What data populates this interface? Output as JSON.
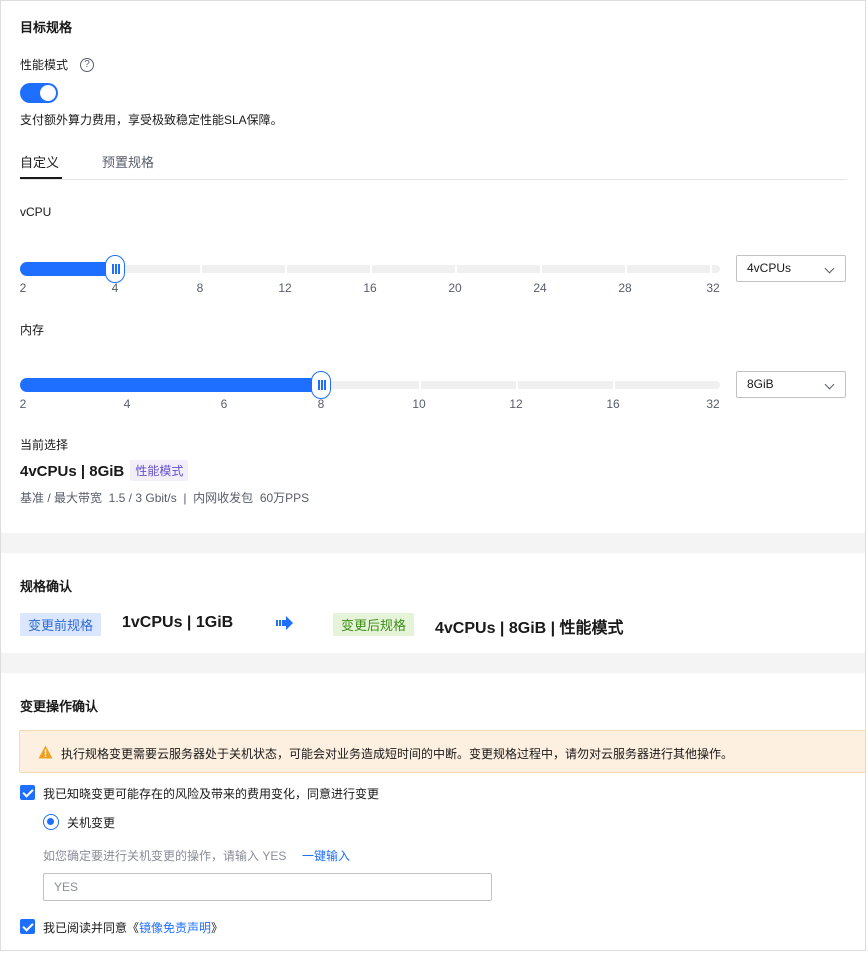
{
  "target_spec": {
    "title": "目标规格",
    "perf_mode_label": "性能模式",
    "help_glyph": "?",
    "perf_mode_enabled": true,
    "perf_mode_desc": "支付额外算力费用，享受极致稳定性能SLA保障。",
    "tabs": [
      {
        "label": "自定义",
        "active": true
      },
      {
        "label": "预置规格",
        "active": false
      }
    ],
    "vcpu": {
      "label": "vCPU",
      "ticks": [
        "2",
        "4",
        "8",
        "12",
        "16",
        "20",
        "24",
        "28",
        "32"
      ],
      "selected_tick": "4",
      "select_value": "4vCPUs"
    },
    "memory": {
      "label": "内存",
      "ticks": [
        "2",
        "4",
        "6",
        "8",
        "10",
        "12",
        "16",
        "32"
      ],
      "selected_tick": "8",
      "select_value": "8GiB"
    },
    "current": {
      "label": "当前选择",
      "value": "4vCPUs | 8GiB",
      "badge": "性能模式",
      "detail": "基准 / 最大带宽  1.5 / 3 Gbit/s  |  内网收发包  60万PPS"
    }
  },
  "confirm_spec": {
    "title": "规格确认",
    "before_label": "变更前规格",
    "before_value": "1vCPUs | 1GiB",
    "arrow_icon": "arrow-right-icon",
    "after_label": "变更后规格",
    "after_value": "4vCPUs | 8GiB | 性能模式"
  },
  "confirm_op": {
    "title": "变更操作确认",
    "warning": "执行规格变更需要云服务器处于关机状态，可能会对业务造成短时间的中断。变更规格过程中，请勿对云服务器进行其他操作。",
    "ack_risk": {
      "checked": true,
      "label": "我已知晓变更可能存在的风险及带来的费用变化，同意进行变更"
    },
    "shutdown_option": {
      "selected": true,
      "label": "关机变更"
    },
    "prompt": "如您确定要进行关机变更的操作，请输入 YES",
    "one_click": "一键输入",
    "input_placeholder": "YES",
    "ack_image": {
      "checked": true,
      "label_prefix": "我已阅读并同意《",
      "link": "镜像免责声明",
      "label_suffix": "》"
    }
  },
  "colors": {
    "accent": "#1e6fff",
    "warning": "#f0a020",
    "purple_badge": "#6450c8",
    "green_tag": "#3f8e18"
  }
}
